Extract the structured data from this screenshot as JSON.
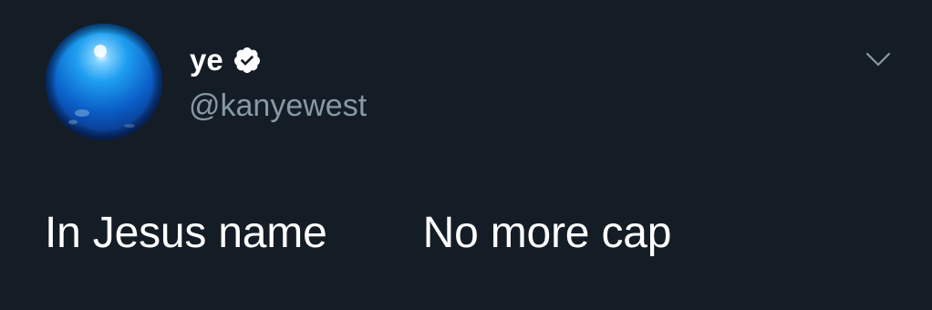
{
  "tweet": {
    "author": {
      "display_name": "ye",
      "handle": "@kanyewest",
      "verified": true,
      "avatar": "blue-globe-avatar"
    },
    "text": "In Jesus name        No more cap",
    "menu_icon": "chevron-down-icon"
  },
  "colors": {
    "background": "#141d26",
    "text_primary": "#ffffff",
    "text_secondary": "#8899a6",
    "verified_badge": "#ffffff"
  }
}
